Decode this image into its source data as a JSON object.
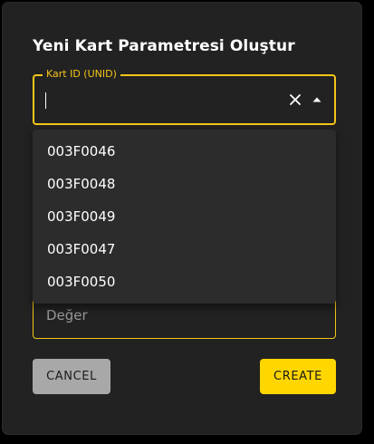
{
  "dialog": {
    "title": "Yeni Kart Parametresi Oluştur"
  },
  "unid_field": {
    "label": "Kart ID (UNID)",
    "value": "",
    "clear_icon": "close-icon",
    "toggle_icon": "arrow-up-icon"
  },
  "dropdown": {
    "options": [
      "003F0046",
      "003F0048",
      "003F0049",
      "003F0047",
      "003F0050"
    ]
  },
  "value_field": {
    "placeholder": "Değer"
  },
  "actions": {
    "cancel_label": "CANCEL",
    "create_label": "CREATE"
  },
  "colors": {
    "accent": "#f5c518",
    "create_button": "#ffd600",
    "cancel_button": "#a8a8a8",
    "dialog_bg": "#222222",
    "dropdown_bg": "#2c2c2c"
  }
}
